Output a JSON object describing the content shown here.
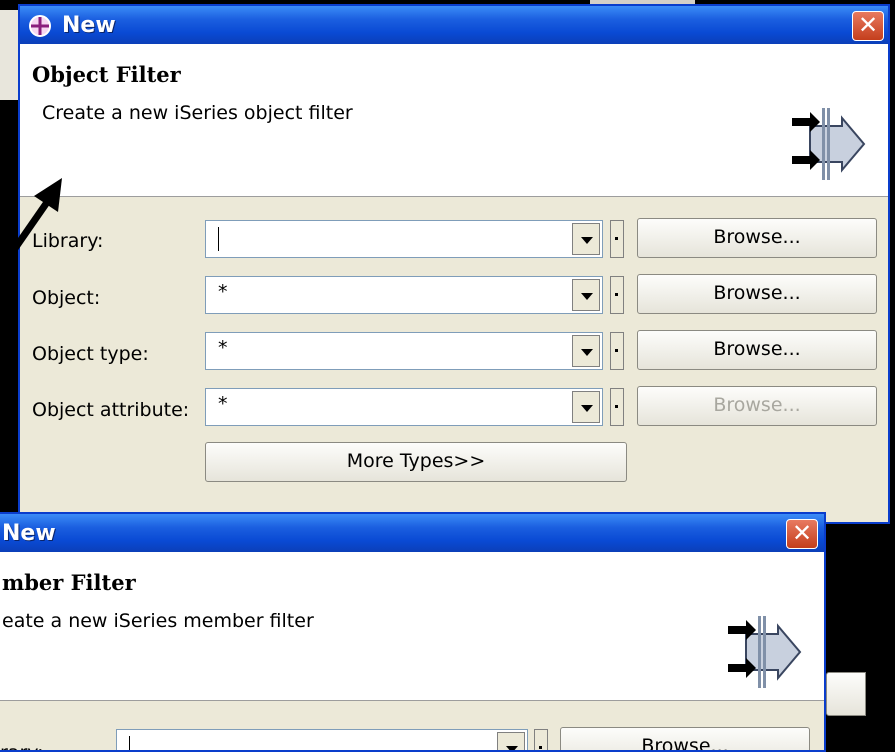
{
  "dialog1": {
    "title": "New",
    "header_title": "Object Filter",
    "header_desc": "Create a new iSeries object filter",
    "close": "✕",
    "rows": [
      {
        "label": "Library:",
        "value": "",
        "browse": "Browse...",
        "browse_enabled": true
      },
      {
        "label": "Object:",
        "value": "*",
        "browse": "Browse...",
        "browse_enabled": true
      },
      {
        "label": "Object type:",
        "value": "*",
        "browse": "Browse...",
        "browse_enabled": true
      },
      {
        "label": "Object attribute:",
        "value": "*",
        "browse": "Browse...",
        "browse_enabled": false
      }
    ],
    "more_types": "More Types>>"
  },
  "dialog2": {
    "title": "New",
    "header_title": "mber Filter",
    "header_desc": "eate a new iSeries member filter",
    "close": "✕",
    "row_label_partial": "rary:",
    "browse": "Browse..."
  },
  "colors": {
    "title_bar": "#0a4ad4",
    "dialog_bg": "#ece9d8",
    "close_button": "#c43e1c"
  }
}
